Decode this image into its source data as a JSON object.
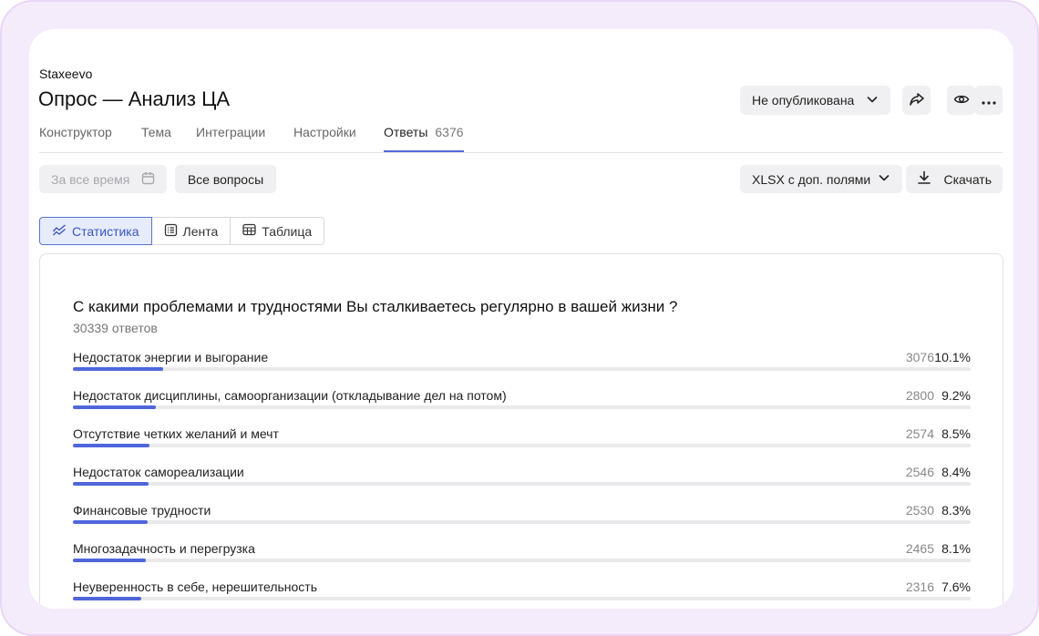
{
  "header": {
    "brand": "Staxeevo",
    "title": "Опрос — Анализ ЦА",
    "publish_status": "Не опубликована"
  },
  "tabs": [
    {
      "label": "Конструктор"
    },
    {
      "label": "Тема"
    },
    {
      "label": "Интеграции"
    },
    {
      "label": "Настройки"
    },
    {
      "label": "Ответы",
      "count": "6376",
      "active": true
    }
  ],
  "filters": {
    "period_placeholder": "За все время",
    "questions_label": "Все вопросы",
    "format_label": "XLSX с доп. полями",
    "download_label": "Скачать"
  },
  "view_switch": [
    {
      "label": "Статистика",
      "icon": "chart-icon",
      "active": true
    },
    {
      "label": "Лента",
      "icon": "list-icon"
    },
    {
      "label": "Таблица",
      "icon": "table-icon"
    }
  ],
  "question": {
    "text": "С какими проблемами и трудностями Вы сталкиваетесь регулярно в вашей жизни ?",
    "total": "30339 ответов",
    "answers": [
      {
        "label": "Недостаток энергии и выгорание",
        "count": "3076",
        "percent": "10.1%",
        "share": 0.101
      },
      {
        "label": "Недостаток дисциплины, самоорганизации (откладывание дел на потом)",
        "count": "2800",
        "percent": "9.2%",
        "share": 0.092
      },
      {
        "label": "Отсутствие четких желаний и мечт",
        "count": "2574",
        "percent": "8.5%",
        "share": 0.085
      },
      {
        "label": "Недостаток самореализации",
        "count": "2546",
        "percent": "8.4%",
        "share": 0.084
      },
      {
        "label": "Финансовые трудности",
        "count": "2530",
        "percent": "8.3%",
        "share": 0.083
      },
      {
        "label": "Многозадачность и перегрузка",
        "count": "2465",
        "percent": "8.1%",
        "share": 0.081
      },
      {
        "label": "Неуверенность в себе, нерешительность",
        "count": "2316",
        "percent": "7.6%",
        "share": 0.076
      }
    ]
  },
  "colors": {
    "accent": "#4f66db",
    "track": "#e9e9ec",
    "frame": "#f5ecfb"
  }
}
